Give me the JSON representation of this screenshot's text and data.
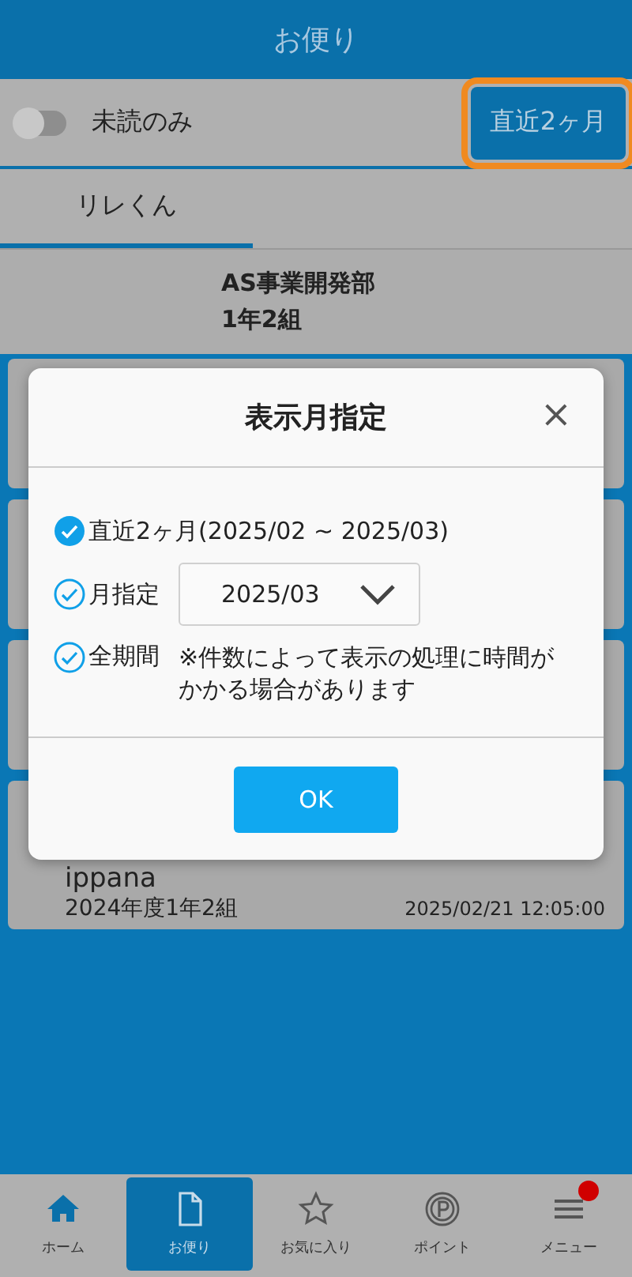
{
  "header": {
    "title": "お便り"
  },
  "filter": {
    "unread_only": {
      "label": "未読のみ",
      "on": false
    },
    "period_button": "直近2ヶ月"
  },
  "tabs": [
    {
      "label": "リレくん",
      "selected": true
    }
  ],
  "group": {
    "organization": "AS事業開発部",
    "class": "1年2組"
  },
  "cards": [
    {
      "title": "ippana",
      "class": "2024年度1年2組",
      "date": "2025/02/21 12:05:00"
    }
  ],
  "dialog": {
    "title": "表示月指定",
    "close": "×",
    "options": [
      {
        "kind": "text",
        "label": "直近2ヶ月(2025/02 ~ 2025/03)",
        "selected": true
      },
      {
        "kind": "select",
        "label": "月指定",
        "value": "2025/03",
        "selected": false
      },
      {
        "kind": "note",
        "label": "全期間",
        "note": "※件数によって表示の処理に時間がかかる場合があります",
        "selected": false
      }
    ],
    "ok": "OK"
  },
  "nav": [
    {
      "kind": "home",
      "label": "ホーム",
      "selected": false,
      "badge": false
    },
    {
      "kind": "document",
      "label": "お便り",
      "selected": true,
      "badge": false
    },
    {
      "kind": "star",
      "label": "お気に入り",
      "selected": false,
      "badge": false
    },
    {
      "kind": "point",
      "label": "ポイント",
      "selected": false,
      "badge": false
    },
    {
      "kind": "menu",
      "label": "メニュー",
      "selected": false,
      "badge": true
    }
  ]
}
